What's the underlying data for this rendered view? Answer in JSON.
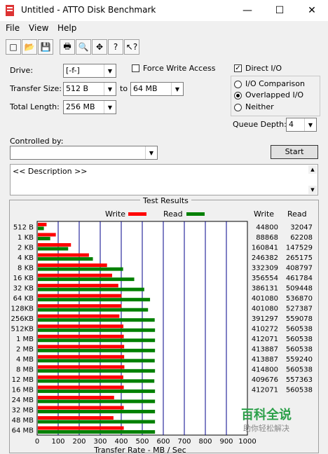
{
  "window": {
    "title": "Untitled - ATTO Disk Benchmark",
    "controls": {
      "minimize": "—",
      "maximize": "☐",
      "close": "✕"
    }
  },
  "menu": [
    "File",
    "View",
    "Help"
  ],
  "toolbar": {
    "icons": [
      "new-icon",
      "open-icon",
      "save-icon",
      "print-icon",
      "print-preview-icon",
      "move-icon",
      "help-icon",
      "context-help-icon"
    ],
    "glyphs": [
      "□",
      "📂",
      "💾",
      "🖶",
      "🔍",
      "✥",
      "?",
      "↖?"
    ]
  },
  "settings": {
    "drive_label": "Drive:",
    "drive_value": "[-f-]",
    "transfer_size_label": "Transfer Size:",
    "transfer_from": "512 B",
    "to_label": "to",
    "transfer_to": "64 MB",
    "total_length_label": "Total Length:",
    "total_length": "256 MB",
    "force_write_label": "Force Write Access",
    "force_write_checked": false,
    "direct_io_label": "Direct I/O",
    "direct_io_checked": true,
    "io_comparison_label": "I/O Comparison",
    "overlapped_io_label": "Overlapped I/O",
    "neither_label": "Neither",
    "selected_mode": "overlapped",
    "queue_depth_label": "Queue Depth:",
    "queue_depth": "4",
    "controlled_by_label": "Controlled by:",
    "controlled_by_value": "",
    "start_label": "Start",
    "description": "<< Description >>"
  },
  "results": {
    "title": "Test Results",
    "write_label": "Write",
    "read_label": "Read",
    "write_col": "Write",
    "read_col": "Read",
    "write_color": "#ff0000",
    "read_color": "#008000",
    "x_label": "Transfer Rate - MB / Sec"
  },
  "chart_data": {
    "type": "bar",
    "orientation": "horizontal",
    "categories": [
      "512 B",
      "1 KB",
      "2 KB",
      "4 KB",
      "8 KB",
      "16 KB",
      "32 KB",
      "64 KB",
      "128KB",
      "256KB",
      "512KB",
      "1 MB",
      "2 MB",
      "4 MB",
      "8 MB",
      "12 MB",
      "16 MB",
      "24 MB",
      "32 MB",
      "48 MB",
      "64 MB"
    ],
    "series": [
      {
        "name": "Write",
        "values": [
          44800,
          88868,
          160841,
          246382,
          332309,
          356554,
          386131,
          401080,
          401080,
          391297,
          410272,
          412071,
          413887,
          413887,
          414800,
          409676,
          412071,
          366000,
          412000,
          363000,
          412000
        ]
      },
      {
        "name": "Read",
        "values": [
          32047,
          62208,
          147529,
          265175,
          408797,
          461784,
          509448,
          536870,
          527387,
          559078,
          560538,
          560538,
          560538,
          559240,
          560538,
          557363,
          560538,
          560538,
          560538,
          560538,
          560538
        ]
      }
    ],
    "write_text": [
      "44800",
      "88868",
      "160841",
      "246382",
      "332309",
      "356554",
      "386131",
      "401080",
      "401080",
      "391297",
      "410272",
      "412071",
      "413887",
      "413887",
      "414800",
      "409676",
      "412071",
      "",
      "",
      "",
      ""
    ],
    "read_text": [
      "32047",
      "62208",
      "147529",
      "265175",
      "408797",
      "461784",
      "509448",
      "536870",
      "527387",
      "559078",
      "560538",
      "560538",
      "560538",
      "559240",
      "560538",
      "557363",
      "560538",
      "",
      "",
      "",
      ""
    ],
    "x_ticks": [
      "0",
      "100",
      "200",
      "300",
      "400",
      "500",
      "600",
      "700",
      "800",
      "900",
      "1000"
    ],
    "xlim": [
      0,
      1000
    ],
    "xlabel": "Transfer Rate - MB / Sec",
    "grid": true
  },
  "watermark": {
    "brand": "百科全说",
    "slogan": "助你轻松解决"
  }
}
